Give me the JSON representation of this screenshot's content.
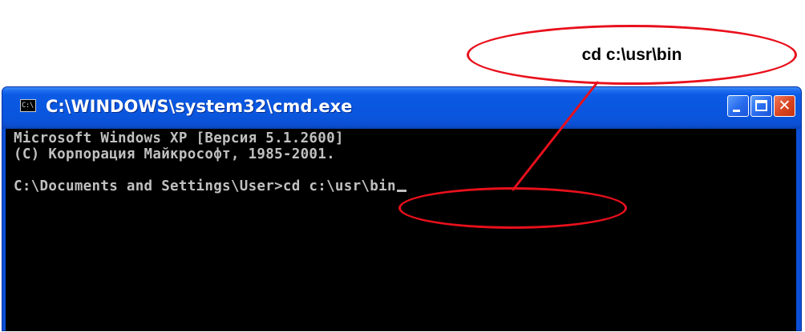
{
  "annotation": {
    "callout_text": "cd c:\\usr\\bin",
    "color": "#e8101c"
  },
  "window": {
    "title": "C:\\WINDOWS\\system32\\cmd.exe",
    "icon_text": "C:\\",
    "titlebar_color": "#0a55dc",
    "close_color": "#d94320"
  },
  "console": {
    "lines": [
      "Microsoft Windows XP [Версия 5.1.2600]",
      "(C) Корпорация Майкрософт, 1985-2001.",
      "C:\\Documents and Settings\\User>cd c:\\usr\\bin"
    ],
    "text_color": "#c0c0c0",
    "background": "#000000"
  }
}
